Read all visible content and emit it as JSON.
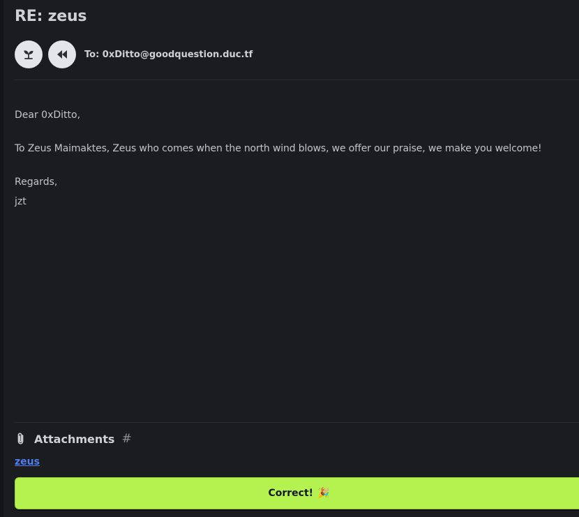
{
  "email": {
    "subject": "RE: zeus",
    "recipient": "To: 0xDitto@goodquestion.duc.tf",
    "avatar_icon": "sprout-icon",
    "reply_icon": "rewind-icon"
  },
  "body": {
    "greeting": "Dear 0xDitto,",
    "message": "To Zeus Maimaktes, Zeus who comes when the north wind blows, we offer our praise, we make you welcome!",
    "closing": "Regards,",
    "sender": "jzt"
  },
  "attachments": {
    "heading": "Attachments",
    "hash_symbol": "#",
    "icon": "paperclip-icon",
    "files": [
      {
        "name": "zeus"
      }
    ]
  },
  "result": {
    "label": "Correct!",
    "emoji": "🎉"
  },
  "colors": {
    "background": "#1b1c20",
    "accent_button": "#b4f24f",
    "link": "#4f7fee"
  }
}
